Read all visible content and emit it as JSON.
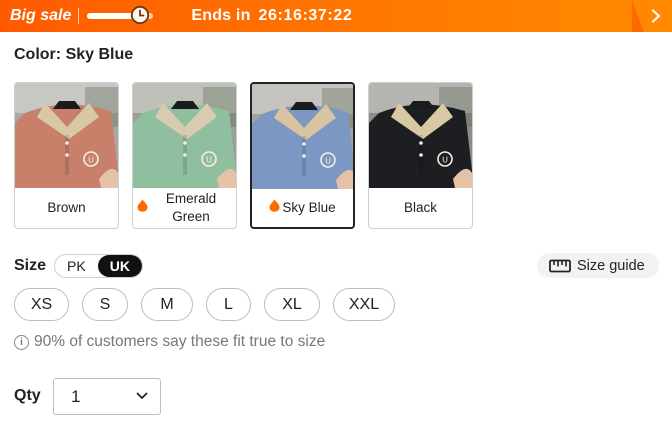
{
  "banner": {
    "title": "Big sale",
    "progress": 0.8,
    "ends_label": "Ends in",
    "timer": "26:16:37:22",
    "icons": {
      "clock": "clock-icon",
      "next": "chevron-right-icon"
    }
  },
  "color": {
    "label": "Color:",
    "selected": "Sky Blue",
    "options": [
      {
        "label": "Brown",
        "hot": false,
        "body": "#c8806a",
        "collar": "#d8c9a6",
        "bg": "#a9a9a4"
      },
      {
        "label": "Emerald Green",
        "hot": true,
        "body": "#8fbf9f",
        "collar": "#d9cbb0",
        "bg": "#9c9f95"
      },
      {
        "label": "Sky Blue",
        "hot": true,
        "body": "#7d97c3",
        "collar": "#d8c3a2",
        "bg": "#a7a49e"
      },
      {
        "label": "Black",
        "hot": false,
        "body": "#1d1e22",
        "collar": "#d8c9a4",
        "bg": "#8d8c88"
      }
    ]
  },
  "size": {
    "label": "Size",
    "units": [
      "PK",
      "UK"
    ],
    "active_unit": "UK",
    "guide_label": "Size guide",
    "options": [
      "XS",
      "S",
      "M",
      "L",
      "XL",
      "XXL"
    ],
    "fit_note": "90% of customers say these fit true to size"
  },
  "qty": {
    "label": "Qty",
    "value": "1"
  },
  "colors": {
    "accent": "#ff6a00",
    "banner_start": "#ff5a00",
    "selected_border": "#222222"
  }
}
